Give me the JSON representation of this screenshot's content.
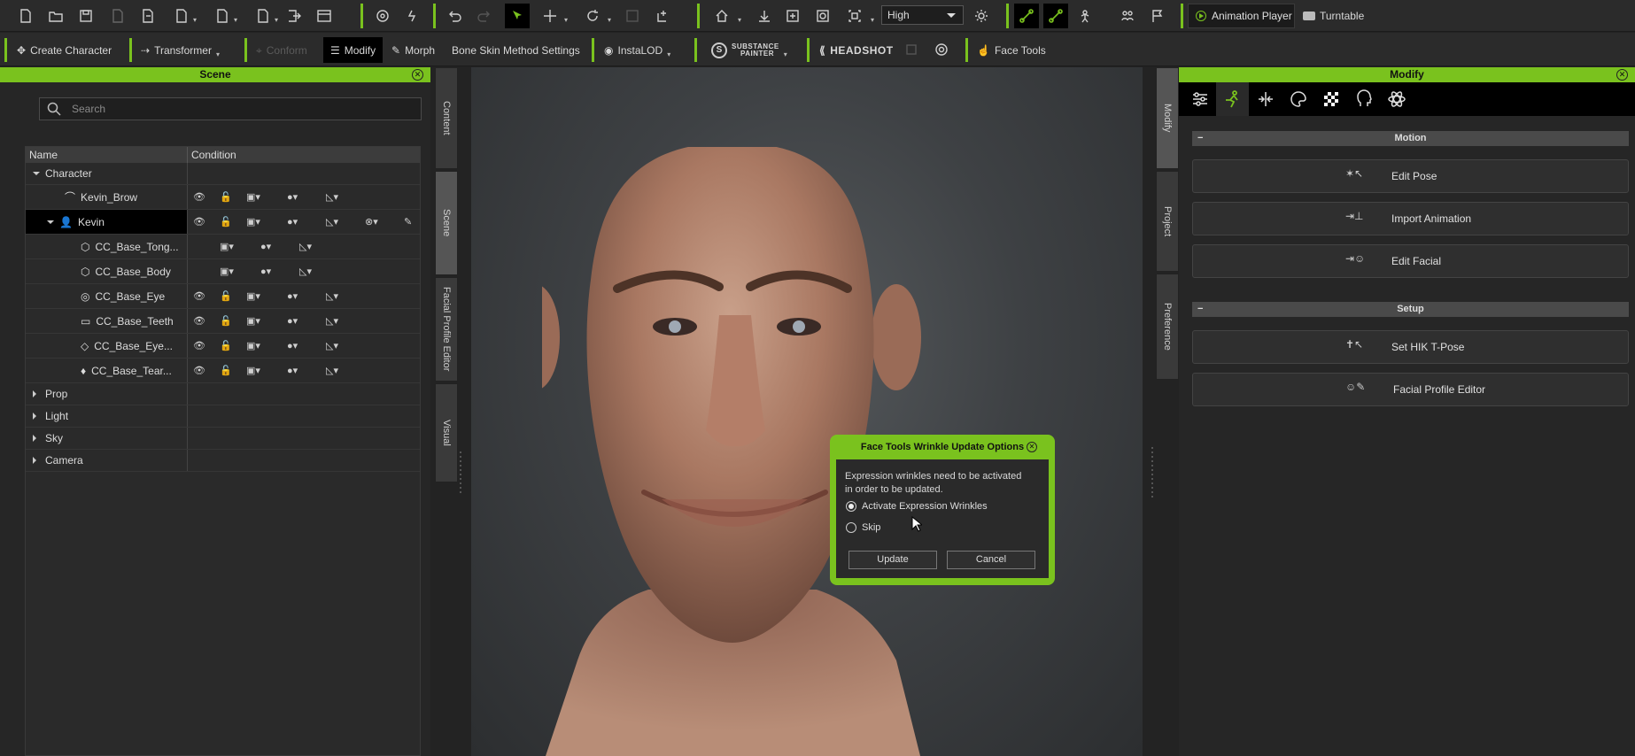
{
  "toolbar1": {
    "quality": "High",
    "animation_player": "Animation Player",
    "turntable": "Turntable",
    "icons": [
      "new-file-icon",
      "open-folder-icon",
      "save-icon",
      "export-icon",
      "import-icon",
      "import-obj-icon",
      "import-fbx-icon",
      "import-usd-icon",
      "send-icon",
      "render-icon",
      "camera-align-icon",
      "walk-icon",
      "undo-icon",
      "redo-icon",
      "select-icon",
      "move-icon",
      "rotate-icon",
      "scale-icon",
      "add-point-icon",
      "home-icon",
      "fit-icon",
      "frame-icon",
      "zoom-icon",
      "view-icon",
      "light-icon",
      "bone-icon",
      "bone-link-icon",
      "skeleton-icon",
      "people-icon",
      "flag-icon"
    ]
  },
  "toolbar2": {
    "create_character": "Create Character",
    "transformer": "Transformer",
    "conform": "Conform",
    "modify": "Modify",
    "morph": "Morph",
    "bone_skin": "Bone Skin Method Settings",
    "instalod": "InstaLOD",
    "substance_top": "SUBSTANCE",
    "substance_bottom": "PAINTER",
    "headshot": "HEADSHOT",
    "face_tools": "Face Tools"
  },
  "scene": {
    "title": "Scene",
    "search_placeholder": "Search",
    "col_name": "Name",
    "col_condition": "Condition",
    "rows": [
      {
        "label": "Character"
      },
      {
        "label": "Kevin_Brow"
      },
      {
        "label": "Kevin"
      },
      {
        "label": "CC_Base_Tong..."
      },
      {
        "label": "CC_Base_Body"
      },
      {
        "label": "CC_Base_Eye"
      },
      {
        "label": "CC_Base_Teeth"
      },
      {
        "label": "CC_Base_Eye..."
      },
      {
        "label": "CC_Base_Tear..."
      },
      {
        "label": "Prop"
      },
      {
        "label": "Light"
      },
      {
        "label": "Sky"
      },
      {
        "label": "Camera"
      }
    ]
  },
  "left_tabs": {
    "content": "Content",
    "scene": "Scene",
    "facial": "Facial Profile Editor",
    "visual": "Visual"
  },
  "right_tabs": {
    "modify": "Modify",
    "project": "Project",
    "preference": "Preference"
  },
  "dialog": {
    "title": "Face Tools Wrinkle Update Options",
    "message": "Expression wrinkles need to be activated in order to be updated.",
    "option1": "Activate Expression Wrinkles",
    "option2": "Skip",
    "selected_option": "Activate Expression Wrinkles",
    "update": "Update",
    "cancel": "Cancel"
  },
  "modify": {
    "title": "Modify",
    "motion": "Motion",
    "edit_pose": "Edit Pose",
    "import_animation": "Import Animation",
    "edit_facial": "Edit Facial",
    "setup": "Setup",
    "hik_tpose": "Set HIK T-Pose",
    "facial_profile": "Facial Profile Editor"
  },
  "colors": {
    "accent": "#7ac21e",
    "panel": "#262626",
    "toolbar": "#2b2b2b"
  }
}
